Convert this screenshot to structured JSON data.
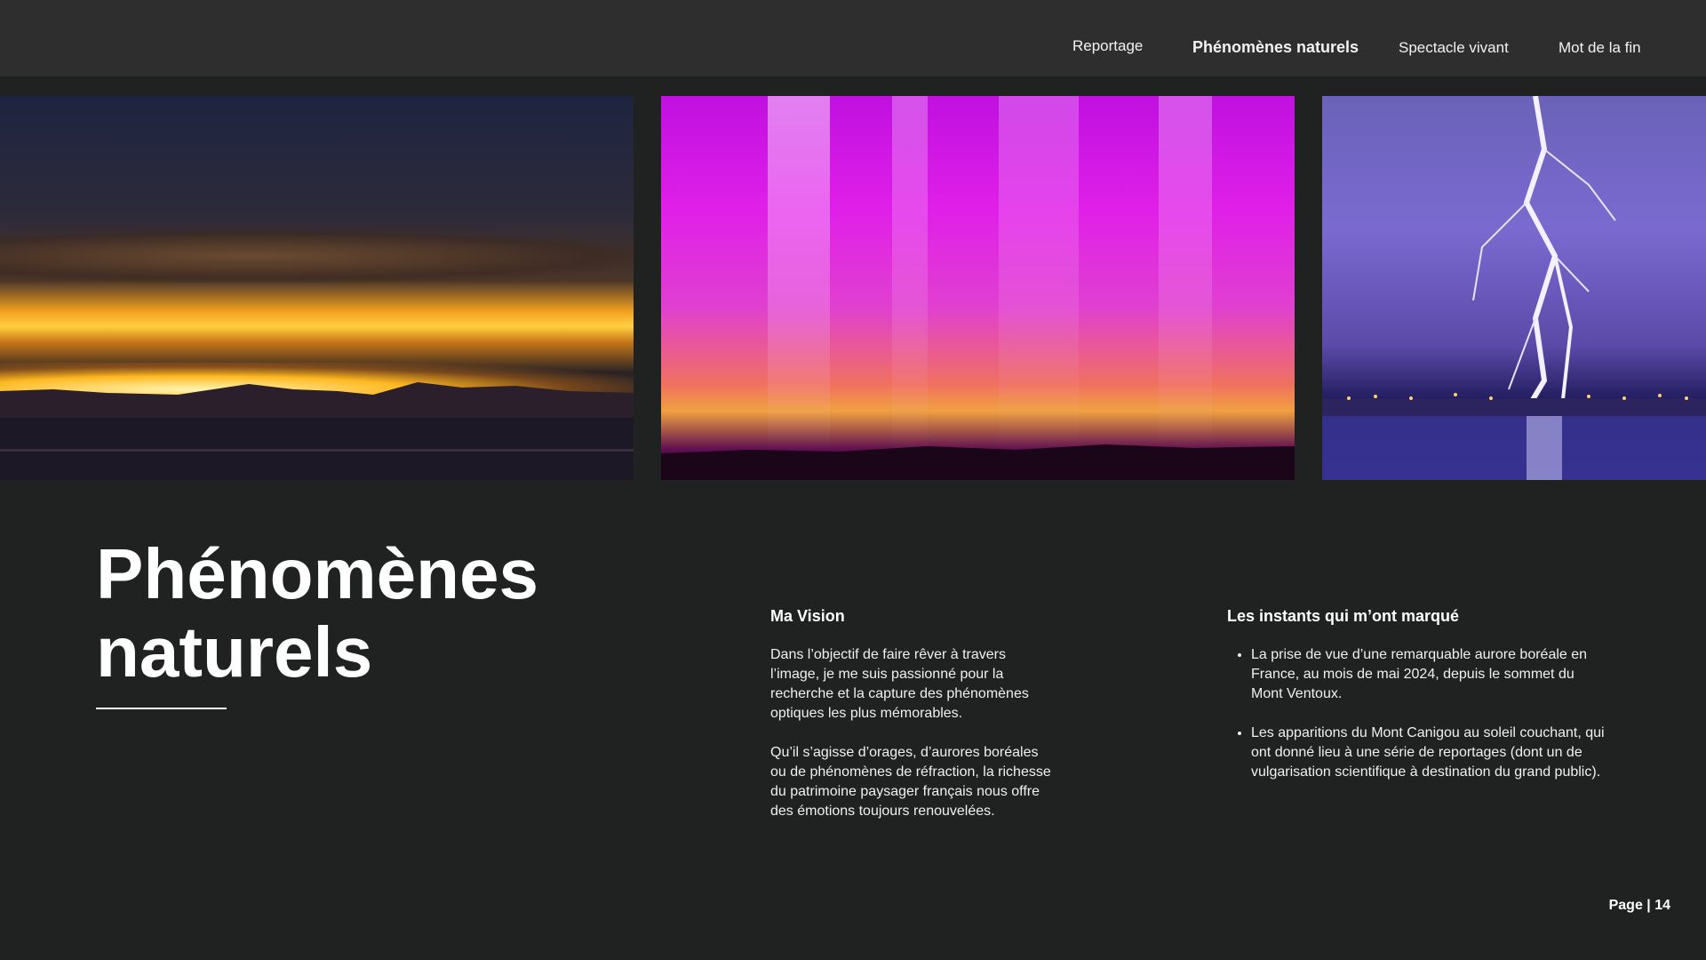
{
  "nav": {
    "items": [
      {
        "label": "Reportage"
      },
      {
        "label": "Phénomènes naturels"
      },
      {
        "label": "Spectacle vivant"
      },
      {
        "label": "Mot de la fin"
      }
    ],
    "active_index": 1
  },
  "photos": [
    {
      "subject": "sunset-over-sea-photo"
    },
    {
      "subject": "aurora-photo"
    },
    {
      "subject": "lightning-over-bay-photo"
    }
  ],
  "title": {
    "line1": "Phénomènes",
    "line2": "naturels"
  },
  "vision": {
    "heading": "Ma Vision",
    "p1": "Dans l’objectif de faire rêver à travers l’image, je me suis passionné pour la recherche et la capture des phénomènes optiques les plus mémorables.",
    "p2": "Qu’il s’agisse d’orages, d’aurores boréales ou de phénomènes de réfraction, la richesse du patrimoine paysager français nous offre des émotions toujours renouvelées."
  },
  "moments": {
    "heading": "Les instants qui m’ont marqué",
    "items": [
      "La prise de vue d’une remarquable aurore boréale en France, au mois de mai 2024, depuis le sommet du Mont Ventoux.",
      "Les apparitions du Mont Canigou au soleil couchant, qui ont donné lieu à une série de reportages (dont un de vulgarisation scientifique à destination du grand public)."
    ]
  },
  "footer": {
    "page_label": "Page | 14"
  },
  "colors": {
    "background": "#202121",
    "topbar": "#2e2e2e",
    "text": "#ffffff"
  }
}
